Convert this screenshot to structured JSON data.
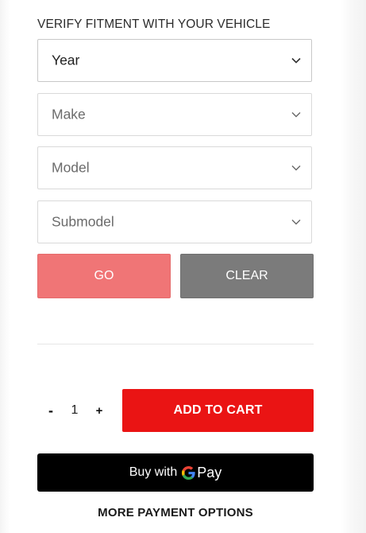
{
  "fitment": {
    "title": "VERIFY FITMENT WITH YOUR VEHICLE",
    "selects": [
      {
        "label": "Year"
      },
      {
        "label": "Make"
      },
      {
        "label": "Model"
      },
      {
        "label": "Submodel"
      }
    ],
    "go_label": "GO",
    "clear_label": "CLEAR"
  },
  "purchase": {
    "minus_label": "-",
    "quantity": "1",
    "plus_label": "+",
    "add_to_cart_label": "ADD TO CART",
    "gpay_prefix": "Buy with",
    "gpay_word": "Pay",
    "more_options_label": "MORE PAYMENT OPTIONS"
  },
  "colors": {
    "go": "#f07576",
    "clear": "#7b7b7b",
    "add_to_cart": "#ea1414",
    "gpay": "#000000"
  },
  "icons": {
    "select_chevron": "chevron-down-icon",
    "google_logo": "google-g-icon"
  }
}
